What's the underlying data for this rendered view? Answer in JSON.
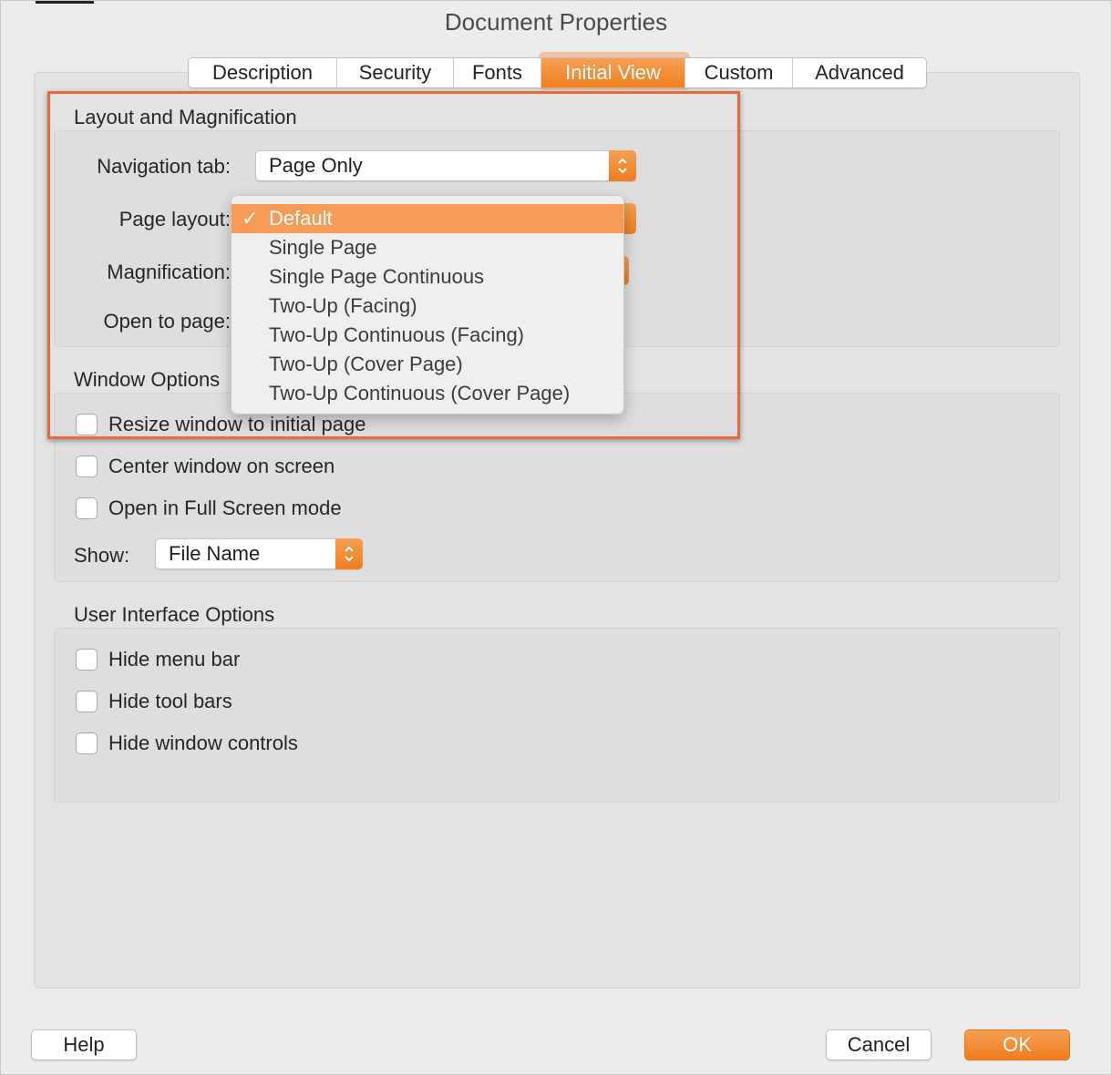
{
  "window": {
    "title": "Document Properties"
  },
  "tabs": [
    {
      "label": "Description"
    },
    {
      "label": "Security"
    },
    {
      "label": "Fonts"
    },
    {
      "label": "Initial View"
    },
    {
      "label": "Custom"
    },
    {
      "label": "Advanced"
    }
  ],
  "active_tab": "Initial View",
  "layout_section": {
    "title": "Layout and Magnification",
    "navigation_tab": {
      "label": "Navigation tab:",
      "value": "Page Only"
    },
    "page_layout": {
      "label": "Page layout:",
      "value": "Default"
    },
    "magnification": {
      "label": "Magnification:"
    },
    "open_to_page": {
      "label": "Open to page:"
    }
  },
  "page_layout_menu": {
    "check_glyph": "✓",
    "items": [
      {
        "label": "Default",
        "selected": true
      },
      {
        "label": "Single Page"
      },
      {
        "label": "Single Page Continuous"
      },
      {
        "label": "Two-Up (Facing)"
      },
      {
        "label": "Two-Up Continuous (Facing)"
      },
      {
        "label": "Two-Up (Cover Page)"
      },
      {
        "label": "Two-Up Continuous (Cover Page)"
      }
    ]
  },
  "window_section": {
    "title": "Window Options",
    "checkboxes": [
      {
        "label": "Resize window to initial page",
        "checked": false
      },
      {
        "label": "Center window on screen",
        "checked": false
      },
      {
        "label": "Open in Full Screen mode",
        "checked": false
      }
    ],
    "show": {
      "label": "Show:",
      "value": "File Name"
    }
  },
  "ui_section": {
    "title": "User Interface Options",
    "checkboxes": [
      {
        "label": "Hide menu bar",
        "checked": false
      },
      {
        "label": "Hide tool bars",
        "checked": false
      },
      {
        "label": "Hide window controls",
        "checked": false
      }
    ]
  },
  "buttons": {
    "help": "Help",
    "cancel": "Cancel",
    "ok": "OK"
  },
  "colors": {
    "accent": "#ef7f1c",
    "highlight_frame": "#e8693c",
    "menu_selection": "#f59b55"
  }
}
